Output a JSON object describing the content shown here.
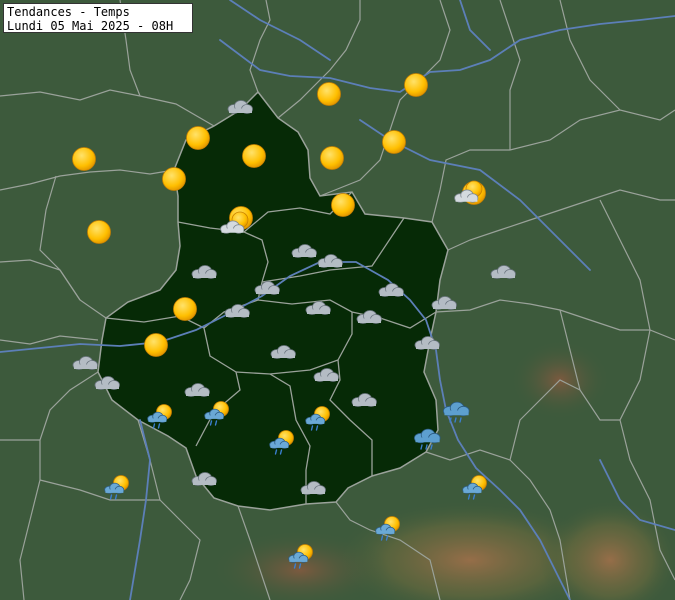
{
  "title": {
    "line1": "Tendances - Temps",
    "line2": "Lundi 05 Mai 2025 - 08H"
  },
  "colors": {
    "background": "#3d5a3c",
    "region_fill": "#062a06",
    "borders": "#9aa29a",
    "rivers": "#5c7fb8",
    "sun": "#ffbf00",
    "cloud": "#b4bcc4",
    "rain_cloud": "#5d9fcf"
  },
  "weather_icons": [
    {
      "type": "sun"
    },
    {
      "type": "sun"
    },
    {
      "type": "sun"
    },
    {
      "type": "sun"
    },
    {
      "type": "sun"
    },
    {
      "type": "sun"
    },
    {
      "type": "sun"
    },
    {
      "type": "sun"
    },
    {
      "type": "sun"
    },
    {
      "type": "sun"
    },
    {
      "type": "sun"
    },
    {
      "type": "sun"
    },
    {
      "type": "sun"
    },
    {
      "type": "sun"
    },
    {
      "type": "cloud"
    },
    {
      "type": "cloud"
    },
    {
      "type": "cloud"
    },
    {
      "type": "cloud"
    },
    {
      "type": "cloud"
    },
    {
      "type": "cloud"
    },
    {
      "type": "cloud"
    },
    {
      "type": "cloud"
    },
    {
      "type": "cloud"
    },
    {
      "type": "cloud"
    },
    {
      "type": "cloud"
    },
    {
      "type": "cloud"
    },
    {
      "type": "cloud"
    },
    {
      "type": "cloud"
    },
    {
      "type": "cloud"
    },
    {
      "type": "cloud"
    },
    {
      "type": "cloud"
    },
    {
      "type": "cloud"
    },
    {
      "type": "cloud"
    },
    {
      "type": "cloud"
    },
    {
      "type": "sun-cloud"
    },
    {
      "type": "sun-cloud"
    },
    {
      "type": "sun-rain"
    },
    {
      "type": "sun-rain"
    },
    {
      "type": "sun-rain"
    },
    {
      "type": "sun-rain"
    },
    {
      "type": "sun-rain"
    },
    {
      "type": "sun-rain"
    },
    {
      "type": "sun-rain"
    },
    {
      "type": "sun-rain"
    },
    {
      "type": "rain"
    },
    {
      "type": "rain"
    }
  ]
}
